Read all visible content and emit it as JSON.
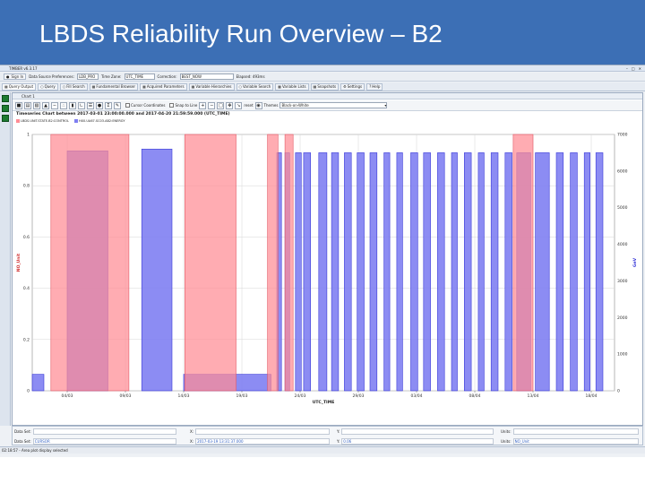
{
  "slide": {
    "title": "LBDS Reliability Run Overview – B2"
  },
  "app": {
    "window_title": "TIMBER v6.3.17",
    "prefs": {
      "sign_in": "Sign In",
      "data_source_label": "Data Source Preferences:",
      "data_source_value": "LDB_PRO",
      "time_zone_label": "Time Zone:",
      "time_zone_value": "UTC_TIME",
      "correction_label": "Correction:",
      "correction_value": "BEST_NOW",
      "elapsed": "Elapsed: 493ms"
    },
    "tabs": [
      {
        "label": "Query Output"
      },
      {
        "label": "Query"
      },
      {
        "label": "Fill Search"
      },
      {
        "label": "Fundamental Browser"
      },
      {
        "label": "Acquired Parameters"
      },
      {
        "label": "Variable Hierarchies"
      },
      {
        "label": "Variable Search"
      },
      {
        "label": "Variable Lists"
      },
      {
        "label": "Snapshots"
      },
      {
        "label": "Settings"
      },
      {
        "label": "Help"
      }
    ],
    "chart_window": {
      "tab_label": "Chart 1",
      "toolbar": {
        "cursor_coords": "Cursor Coordinates",
        "snap_to_line": "Snap to Line",
        "reset": "reset",
        "themes_label": "Themes",
        "theme_value": "Black-on-White"
      }
    },
    "bottom": {
      "data_set_label": "Data Set:",
      "data_set_value": "",
      "x_label": "X:",
      "x_value": "",
      "y_label": "Y:",
      "y_value": "",
      "units_label": "Units:",
      "units_value": "",
      "data_set2_label": "Data Set:",
      "data_set2_value": "CURSOR",
      "x2_label": "X:",
      "x2_value": "2017-03-19 13:31:37.000",
      "y2_label": "Y:",
      "y2_value": "0.06",
      "units2_label": "Units:",
      "units2_value": "NO_Unit"
    },
    "status": "02:18:57 - Area plot display selected"
  },
  "chart_data": {
    "type": "area",
    "title": "Timeseries Chart between 2017-03-01 23:00:00.000 and 2017-04-20 21:59:59.000 (UTC_TIME)",
    "xlabel": "UTC_TIME",
    "ylabel_left": "NO_Unit",
    "ylabel_right": "GeV",
    "x_ticks": [
      "04/03",
      "09/03",
      "14/03",
      "19/03",
      "24/03",
      "29/03",
      "03/04",
      "08/04",
      "13/04",
      "18/04"
    ],
    "y_left_ticks": [
      "0",
      "0.2",
      "0.4",
      "0.6",
      "0.8",
      "1"
    ],
    "y_left_range": [
      0,
      1
    ],
    "y_right_ticks": [
      "0",
      "1000",
      "2000",
      "3000",
      "4000",
      "5000",
      "6000",
      "7000"
    ],
    "y_right_range": [
      0,
      7000
    ],
    "grid": true,
    "legend_position": "top-left",
    "series": [
      {
        "name": "LBDS.UNIT.STATE.B2:CONTROL",
        "color": "#ff8c94",
        "axis": "left",
        "segments": [
          {
            "start": 1.6,
            "end": 8.3,
            "value": 1
          },
          {
            "start": 13.1,
            "end": 17.5,
            "value": 1
          },
          {
            "start": 20.2,
            "end": 21.1,
            "value": 1
          },
          {
            "start": 21.7,
            "end": 22.4,
            "value": 1
          },
          {
            "start": 41.3,
            "end": 43.0,
            "value": 1
          }
        ]
      },
      {
        "name": "HX0.UA67.SC03.AB2:ENERGY",
        "color": "#7f7ff2",
        "axis": "right",
        "segments": [
          {
            "start": 0.0,
            "end": 1.0,
            "value": 450
          },
          {
            "start": 3.0,
            "end": 6.5,
            "value": 6550
          },
          {
            "start": 9.4,
            "end": 12.0,
            "value": 6600
          },
          {
            "start": 13.0,
            "end": 20.5,
            "value": 450
          },
          {
            "start": 21.0,
            "end": 21.4,
            "value": 6500
          },
          {
            "start": 21.7,
            "end": 22.1,
            "value": 6500
          },
          {
            "start": 22.6,
            "end": 23.1,
            "value": 6500
          },
          {
            "start": 23.3,
            "end": 23.9,
            "value": 6500
          },
          {
            "start": 24.6,
            "end": 25.3,
            "value": 6500
          },
          {
            "start": 25.7,
            "end": 26.3,
            "value": 6500
          },
          {
            "start": 26.8,
            "end": 27.4,
            "value": 6500
          },
          {
            "start": 27.9,
            "end": 28.5,
            "value": 6500
          },
          {
            "start": 29.0,
            "end": 29.6,
            "value": 6500
          },
          {
            "start": 30.2,
            "end": 30.7,
            "value": 6500
          },
          {
            "start": 31.3,
            "end": 31.8,
            "value": 6500
          },
          {
            "start": 32.5,
            "end": 33.1,
            "value": 6500
          },
          {
            "start": 33.6,
            "end": 34.2,
            "value": 6500
          },
          {
            "start": 34.8,
            "end": 35.4,
            "value": 6500
          },
          {
            "start": 36.0,
            "end": 36.5,
            "value": 6500
          },
          {
            "start": 37.1,
            "end": 37.7,
            "value": 6500
          },
          {
            "start": 38.3,
            "end": 38.8,
            "value": 6500
          },
          {
            "start": 39.4,
            "end": 40.0,
            "value": 6500
          },
          {
            "start": 40.6,
            "end": 41.2,
            "value": 6500
          },
          {
            "start": 41.6,
            "end": 42.8,
            "value": 6500
          },
          {
            "start": 43.2,
            "end": 44.4,
            "value": 6500
          },
          {
            "start": 45.0,
            "end": 45.6,
            "value": 6500
          },
          {
            "start": 46.2,
            "end": 46.8,
            "value": 6500
          },
          {
            "start": 47.4,
            "end": 47.9,
            "value": 6500
          },
          {
            "start": 48.4,
            "end": 49.0,
            "value": 6500
          }
        ]
      }
    ]
  }
}
